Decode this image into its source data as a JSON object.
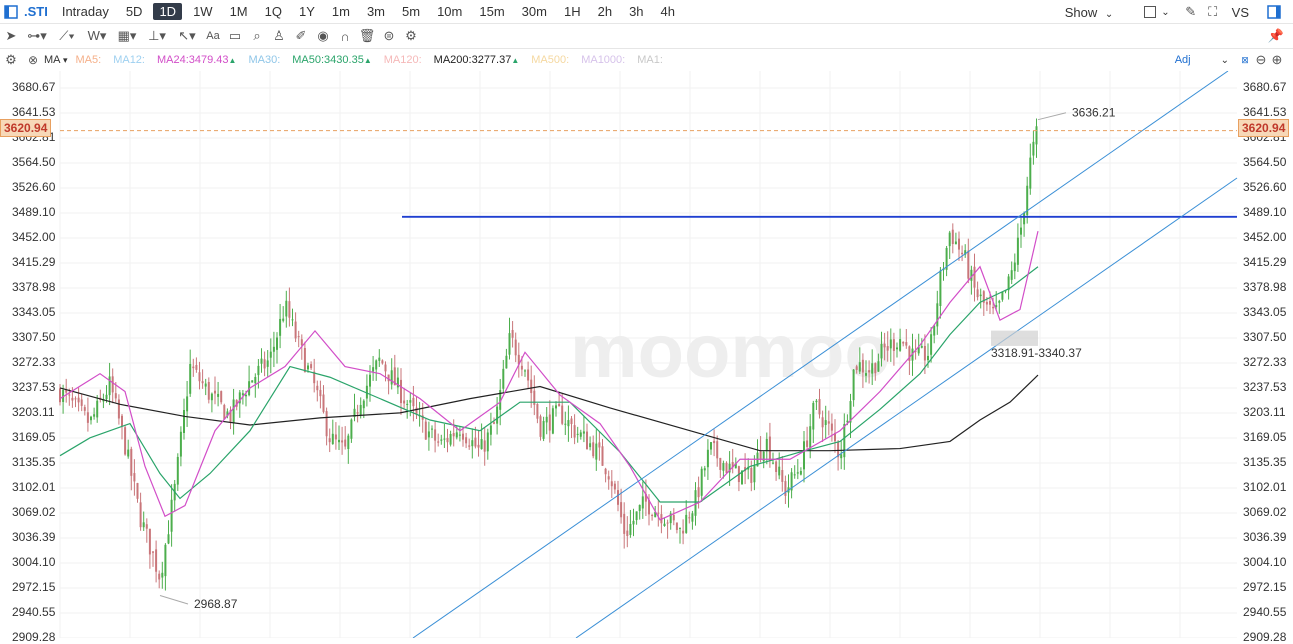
{
  "toolbar": {
    "symbol": ".STI",
    "timeframes": [
      "Intraday",
      "5D",
      "1D",
      "1W",
      "1M",
      "1Q",
      "1Y",
      "1m",
      "3m",
      "5m",
      "10m",
      "15m",
      "30m",
      "1H",
      "2h",
      "3h",
      "4h"
    ],
    "active_timeframe": "1D",
    "show_label": "Show",
    "vs_label": "VS"
  },
  "drawing_tools": [
    "cursor-icon",
    "line-icon",
    "polyline-icon",
    "wave-icon",
    "fib-icon",
    "measure-icon",
    "arrow-icon",
    "text-icon",
    "comment-icon",
    "zoom-icon",
    "crowd-icon",
    "pen-icon",
    "eye-icon",
    "magnet-icon",
    "trash-icon",
    "layers-icon",
    "settings-icon"
  ],
  "indicator_bar": {
    "ma_label": "MA",
    "items": [
      {
        "label": "MA5:",
        "color": "#f5b08a"
      },
      {
        "label": "MA12:",
        "color": "#9ed0f0"
      },
      {
        "label": "MA24:3479.43",
        "color": "#d24ec8",
        "arrow": "▲"
      },
      {
        "label": "MA30:",
        "color": "#8fc6e8"
      },
      {
        "label": "MA50:3430.35",
        "color": "#2aa46a",
        "arrow": "▲"
      },
      {
        "label": "MA120:",
        "color": "#f5b8b8"
      },
      {
        "label": "MA200:3277.37",
        "color": "#222222",
        "arrow": "▲"
      },
      {
        "label": "MA500:",
        "color": "#f5d8a0"
      },
      {
        "label": "MA1000:",
        "color": "#d6c2ea"
      },
      {
        "label": "MA1:",
        "color": "#c8c8c8"
      }
    ],
    "adj_label": "Adj"
  },
  "price_axis": {
    "ticks": [
      "3680.67",
      "3641.53",
      "3602.81",
      "3564.50",
      "3526.60",
      "3489.10",
      "3452.00",
      "3415.29",
      "3378.98",
      "3343.05",
      "3307.50",
      "3272.33",
      "3237.53",
      "3203.11",
      "3169.05",
      "3135.35",
      "3102.01",
      "3069.02",
      "3036.39",
      "3004.10",
      "2972.15",
      "2940.55",
      "2909.28"
    ],
    "current_price": "3620.94"
  },
  "annotations": {
    "high": "3636.21",
    "low": "2968.87",
    "range": "3318.91-3340.37"
  },
  "watermark": "moomoo",
  "colors": {
    "up": "#4cae4c",
    "down": "#c9767a",
    "accent": "#1f6fd0",
    "current_price": "#e8a060",
    "hline": "#1f3fd0",
    "channel": "#3a8fd6"
  }
}
